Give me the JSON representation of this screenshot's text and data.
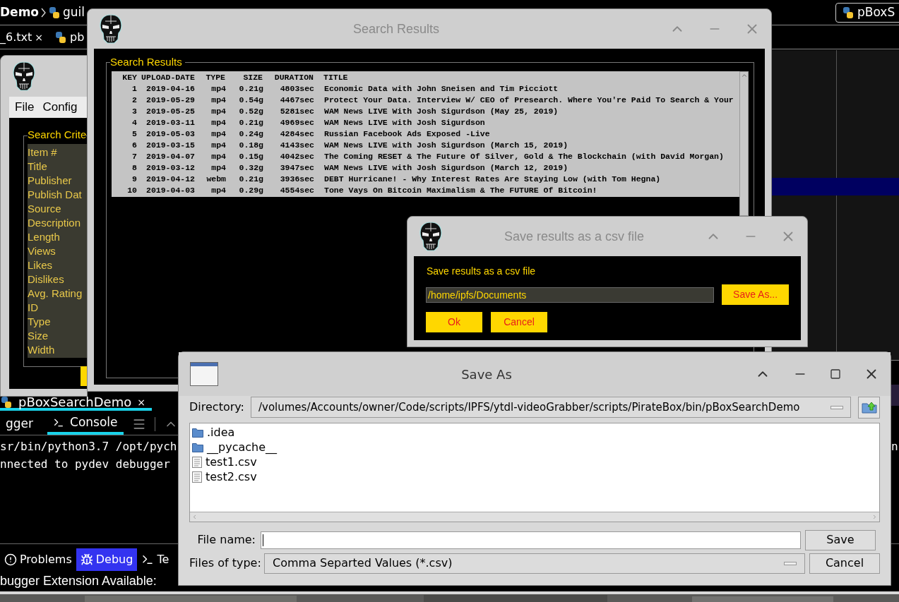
{
  "ide": {
    "breadcrumb": [
      "Demo",
      "guil"
    ],
    "editor_tabs": [
      {
        "label": "_6.txt",
        "close": "×"
      },
      {
        "label": "pb"
      }
    ],
    "run_config": "pBoxS",
    "run_tab": {
      "label": "pBoxSearchDemo",
      "close": "×"
    },
    "console_tabs": [
      {
        "label": "gger",
        "selected": false
      },
      {
        "label": "Console",
        "selected": true
      }
    ],
    "console_lines": [
      "sr/bin/python3.7 /opt/pych",
      "nnected to pydev debugger"
    ],
    "console_edge_text": "n",
    "tool_tabs": [
      {
        "label": "Problems",
        "kind": "problems",
        "selected": false
      },
      {
        "label": "Debug",
        "kind": "debug",
        "selected": true
      },
      {
        "label": "Te",
        "kind": "terminal",
        "selected": false
      }
    ],
    "status": "bugger Extension Available:"
  },
  "criteria_window": {
    "menu": [
      "File",
      "Config"
    ],
    "frame_title": "Search Crite",
    "fields": [
      "Item #",
      "Title",
      "Publisher",
      "Publish Dat",
      "Source",
      "Description",
      "Length",
      "Views",
      "Likes",
      "Dislikes",
      "Avg. Rating",
      "ID",
      "Type",
      "Size",
      "Width"
    ]
  },
  "results_window": {
    "title": "Search Results",
    "frame_title": "Search Results",
    "header": {
      "key": "KEY",
      "date": "UPLOAD-DATE",
      "type": "TYPE",
      "size": "SIZE",
      "duration": "DURATION",
      "title": "TITLE"
    },
    "rows": [
      {
        "key": "1",
        "date": "2019-04-16",
        "type": "mp4",
        "size": "0.21g",
        "duration": "4803sec",
        "title": "Economic Data with John Sneisen and Tim Picciott"
      },
      {
        "key": "2",
        "date": "2019-05-29",
        "type": "mp4",
        "size": "0.54g",
        "duration": "4467sec",
        "title": "Protect Your Data. Interview W/ CEO of Presearch. Where You're Paid To Search & Your"
      },
      {
        "key": "3",
        "date": "2019-05-25",
        "type": "mp4",
        "size": "0.52g",
        "duration": "5281sec",
        "title": "WAM News LIVE With Josh Sigurdson (May 25, 2019)"
      },
      {
        "key": "4",
        "date": "2019-03-11",
        "type": "mp4",
        "size": "0.21g",
        "duration": "4969sec",
        "title": "WAM News LIVE with Josh Sigurdson"
      },
      {
        "key": "5",
        "date": "2019-05-03",
        "type": "mp4",
        "size": "0.24g",
        "duration": "4284sec",
        "title": "Russian Facebook Ads Exposed -Live"
      },
      {
        "key": "6",
        "date": "2019-03-15",
        "type": "mp4",
        "size": "0.18g",
        "duration": "4143sec",
        "title": "WAM News LIVE with Josh Sigurdson (March 15, 2019)"
      },
      {
        "key": "7",
        "date": "2019-04-07",
        "type": "mp4",
        "size": "0.15g",
        "duration": "4042sec",
        "title": "The Coming RESET & The Future Of Silver, Gold & The Blockchain (with David Morgan)"
      },
      {
        "key": "8",
        "date": "2019-03-12",
        "type": "mp4",
        "size": "0.32g",
        "duration": "3947sec",
        "title": "WAM News LIVE with Josh Sigurdson (March 12, 2019)"
      },
      {
        "key": "9",
        "date": "2019-04-12",
        "type": "webm",
        "size": "0.21g",
        "duration": "3936sec",
        "title": "DEBT Hurricane! - Why Interest Rates Are Staying Low (with Tom Hegna)"
      },
      {
        "key": "10",
        "date": "2019-04-03",
        "type": "mp4",
        "size": "0.29g",
        "duration": "4554sec",
        "title": "Tone Vays On Bitcoin Maximalism & The FUTURE Of Bitcoin!"
      }
    ]
  },
  "csv_dialog": {
    "title": "Save results as a csv file",
    "prompt": "Save results as a csv file",
    "path": "/home/ipfs/Documents",
    "browse_button": "Save As...",
    "ok_button": "Ok",
    "cancel_button": "Cancel"
  },
  "save_as_dialog": {
    "title": "Save As",
    "directory_label": "Directory:",
    "directory": "/volumes/Accounts/owner/Code/scripts/IPFS/ytdl-videoGrabber/scripts/PirateBox/bin/pBoxSearchDemo",
    "files": [
      {
        "name": ".idea",
        "kind": "folder"
      },
      {
        "name": "__pycache__",
        "kind": "folder"
      },
      {
        "name": "test1.csv",
        "kind": "file"
      },
      {
        "name": "test2.csv",
        "kind": "file"
      }
    ],
    "file_name_label": "File name:",
    "file_type_label": "Files of type:",
    "file_type": "Comma Separted Values (*.csv)",
    "save_button": "Save",
    "cancel_button": "Cancel"
  }
}
